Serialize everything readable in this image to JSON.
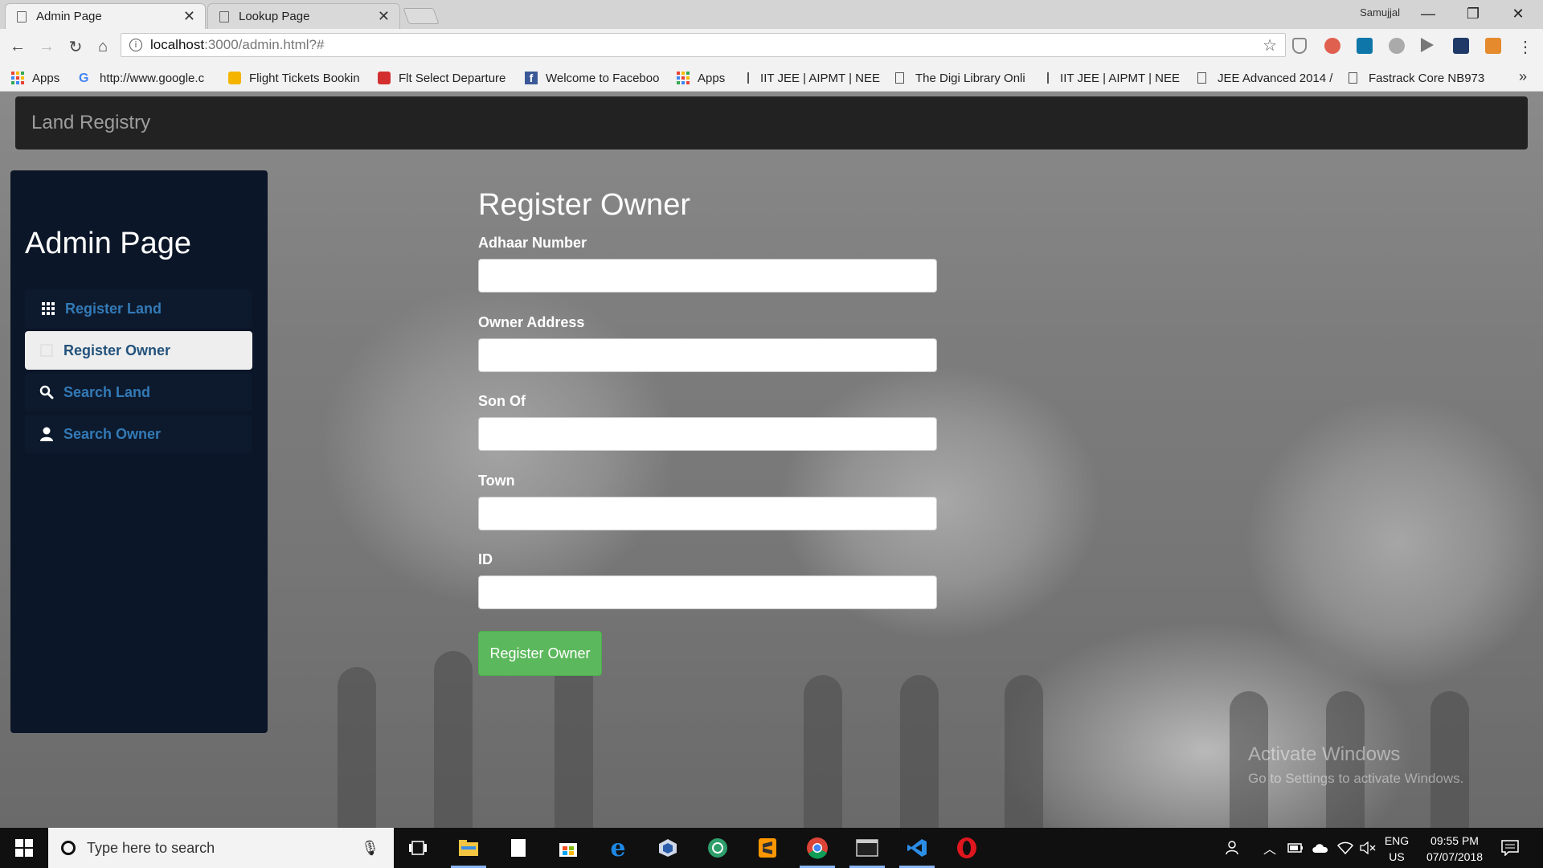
{
  "browser": {
    "tabs": [
      {
        "title": "Admin Page",
        "active": true
      },
      {
        "title": "Lookup Page",
        "active": false
      }
    ],
    "user_name": "Samujjal",
    "url_host": "localhost",
    "url_path": ":3000/admin.html?#",
    "bookmarks": [
      "Apps",
      "http://www.google.c",
      "Flight Tickets Bookin",
      "Flt Select Departure",
      "Welcome to Faceboo",
      "Apps",
      "IIT JEE | AIPMT | NEE",
      "The Digi Library Onli",
      "IIT JEE | AIPMT | NEE",
      "JEE Advanced 2014 /",
      "Fastrack Core NB973"
    ],
    "bookmarks_more": "»"
  },
  "navbar": {
    "brand": "Land Registry"
  },
  "sidebar": {
    "title": "Admin Page",
    "items": [
      {
        "label": "Register Land",
        "icon": "grid-icon"
      },
      {
        "label": "Register Owner",
        "icon": "list-icon"
      },
      {
        "label": "Search Land",
        "icon": "search-icon"
      },
      {
        "label": "Search Owner",
        "icon": "user-icon"
      }
    ]
  },
  "form": {
    "title": "Register Owner",
    "fields": [
      {
        "label": "Adhaar Number",
        "value": ""
      },
      {
        "label": "Owner Address",
        "value": ""
      },
      {
        "label": "Son Of",
        "value": ""
      },
      {
        "label": "Town",
        "value": ""
      },
      {
        "label": "ID",
        "value": ""
      }
    ],
    "submit_label": "Register Owner"
  },
  "watermark": {
    "line1": "Activate Windows",
    "line2": "Go to Settings to activate Windows."
  },
  "taskbar": {
    "search_placeholder": "Type here to search",
    "lang_line1": "ENG",
    "lang_line2": "US",
    "time": "09:55 PM",
    "date": "07/07/2018"
  },
  "colors": {
    "navbar_bg": "#222222",
    "sidebar_bg": "#0b1628",
    "link": "#337ab7",
    "button_success": "#5cb85c"
  }
}
